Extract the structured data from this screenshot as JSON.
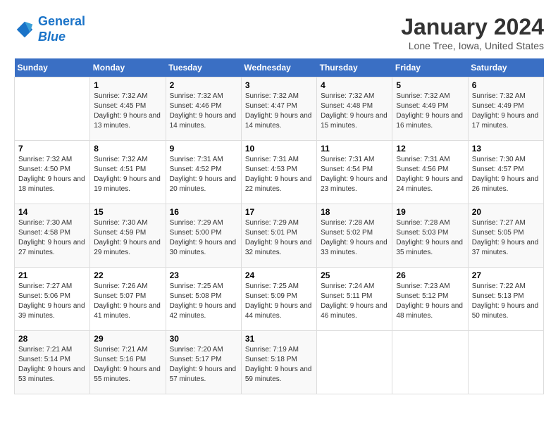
{
  "header": {
    "logo_line1": "General",
    "logo_line2": "Blue",
    "month_title": "January 2024",
    "location": "Lone Tree, Iowa, United States"
  },
  "weekdays": [
    "Sunday",
    "Monday",
    "Tuesday",
    "Wednesday",
    "Thursday",
    "Friday",
    "Saturday"
  ],
  "weeks": [
    [
      {
        "day": "",
        "sunrise": "",
        "sunset": "",
        "daylight": ""
      },
      {
        "day": "1",
        "sunrise": "Sunrise: 7:32 AM",
        "sunset": "Sunset: 4:45 PM",
        "daylight": "Daylight: 9 hours and 13 minutes."
      },
      {
        "day": "2",
        "sunrise": "Sunrise: 7:32 AM",
        "sunset": "Sunset: 4:46 PM",
        "daylight": "Daylight: 9 hours and 14 minutes."
      },
      {
        "day": "3",
        "sunrise": "Sunrise: 7:32 AM",
        "sunset": "Sunset: 4:47 PM",
        "daylight": "Daylight: 9 hours and 14 minutes."
      },
      {
        "day": "4",
        "sunrise": "Sunrise: 7:32 AM",
        "sunset": "Sunset: 4:48 PM",
        "daylight": "Daylight: 9 hours and 15 minutes."
      },
      {
        "day": "5",
        "sunrise": "Sunrise: 7:32 AM",
        "sunset": "Sunset: 4:49 PM",
        "daylight": "Daylight: 9 hours and 16 minutes."
      },
      {
        "day": "6",
        "sunrise": "Sunrise: 7:32 AM",
        "sunset": "Sunset: 4:49 PM",
        "daylight": "Daylight: 9 hours and 17 minutes."
      }
    ],
    [
      {
        "day": "7",
        "sunrise": "Sunrise: 7:32 AM",
        "sunset": "Sunset: 4:50 PM",
        "daylight": "Daylight: 9 hours and 18 minutes."
      },
      {
        "day": "8",
        "sunrise": "Sunrise: 7:32 AM",
        "sunset": "Sunset: 4:51 PM",
        "daylight": "Daylight: 9 hours and 19 minutes."
      },
      {
        "day": "9",
        "sunrise": "Sunrise: 7:31 AM",
        "sunset": "Sunset: 4:52 PM",
        "daylight": "Daylight: 9 hours and 20 minutes."
      },
      {
        "day": "10",
        "sunrise": "Sunrise: 7:31 AM",
        "sunset": "Sunset: 4:53 PM",
        "daylight": "Daylight: 9 hours and 22 minutes."
      },
      {
        "day": "11",
        "sunrise": "Sunrise: 7:31 AM",
        "sunset": "Sunset: 4:54 PM",
        "daylight": "Daylight: 9 hours and 23 minutes."
      },
      {
        "day": "12",
        "sunrise": "Sunrise: 7:31 AM",
        "sunset": "Sunset: 4:56 PM",
        "daylight": "Daylight: 9 hours and 24 minutes."
      },
      {
        "day": "13",
        "sunrise": "Sunrise: 7:30 AM",
        "sunset": "Sunset: 4:57 PM",
        "daylight": "Daylight: 9 hours and 26 minutes."
      }
    ],
    [
      {
        "day": "14",
        "sunrise": "Sunrise: 7:30 AM",
        "sunset": "Sunset: 4:58 PM",
        "daylight": "Daylight: 9 hours and 27 minutes."
      },
      {
        "day": "15",
        "sunrise": "Sunrise: 7:30 AM",
        "sunset": "Sunset: 4:59 PM",
        "daylight": "Daylight: 9 hours and 29 minutes."
      },
      {
        "day": "16",
        "sunrise": "Sunrise: 7:29 AM",
        "sunset": "Sunset: 5:00 PM",
        "daylight": "Daylight: 9 hours and 30 minutes."
      },
      {
        "day": "17",
        "sunrise": "Sunrise: 7:29 AM",
        "sunset": "Sunset: 5:01 PM",
        "daylight": "Daylight: 9 hours and 32 minutes."
      },
      {
        "day": "18",
        "sunrise": "Sunrise: 7:28 AM",
        "sunset": "Sunset: 5:02 PM",
        "daylight": "Daylight: 9 hours and 33 minutes."
      },
      {
        "day": "19",
        "sunrise": "Sunrise: 7:28 AM",
        "sunset": "Sunset: 5:03 PM",
        "daylight": "Daylight: 9 hours and 35 minutes."
      },
      {
        "day": "20",
        "sunrise": "Sunrise: 7:27 AM",
        "sunset": "Sunset: 5:05 PM",
        "daylight": "Daylight: 9 hours and 37 minutes."
      }
    ],
    [
      {
        "day": "21",
        "sunrise": "Sunrise: 7:27 AM",
        "sunset": "Sunset: 5:06 PM",
        "daylight": "Daylight: 9 hours and 39 minutes."
      },
      {
        "day": "22",
        "sunrise": "Sunrise: 7:26 AM",
        "sunset": "Sunset: 5:07 PM",
        "daylight": "Daylight: 9 hours and 41 minutes."
      },
      {
        "day": "23",
        "sunrise": "Sunrise: 7:25 AM",
        "sunset": "Sunset: 5:08 PM",
        "daylight": "Daylight: 9 hours and 42 minutes."
      },
      {
        "day": "24",
        "sunrise": "Sunrise: 7:25 AM",
        "sunset": "Sunset: 5:09 PM",
        "daylight": "Daylight: 9 hours and 44 minutes."
      },
      {
        "day": "25",
        "sunrise": "Sunrise: 7:24 AM",
        "sunset": "Sunset: 5:11 PM",
        "daylight": "Daylight: 9 hours and 46 minutes."
      },
      {
        "day": "26",
        "sunrise": "Sunrise: 7:23 AM",
        "sunset": "Sunset: 5:12 PM",
        "daylight": "Daylight: 9 hours and 48 minutes."
      },
      {
        "day": "27",
        "sunrise": "Sunrise: 7:22 AM",
        "sunset": "Sunset: 5:13 PM",
        "daylight": "Daylight: 9 hours and 50 minutes."
      }
    ],
    [
      {
        "day": "28",
        "sunrise": "Sunrise: 7:21 AM",
        "sunset": "Sunset: 5:14 PM",
        "daylight": "Daylight: 9 hours and 53 minutes."
      },
      {
        "day": "29",
        "sunrise": "Sunrise: 7:21 AM",
        "sunset": "Sunset: 5:16 PM",
        "daylight": "Daylight: 9 hours and 55 minutes."
      },
      {
        "day": "30",
        "sunrise": "Sunrise: 7:20 AM",
        "sunset": "Sunset: 5:17 PM",
        "daylight": "Daylight: 9 hours and 57 minutes."
      },
      {
        "day": "31",
        "sunrise": "Sunrise: 7:19 AM",
        "sunset": "Sunset: 5:18 PM",
        "daylight": "Daylight: 9 hours and 59 minutes."
      },
      {
        "day": "",
        "sunrise": "",
        "sunset": "",
        "daylight": ""
      },
      {
        "day": "",
        "sunrise": "",
        "sunset": "",
        "daylight": ""
      },
      {
        "day": "",
        "sunrise": "",
        "sunset": "",
        "daylight": ""
      }
    ]
  ]
}
